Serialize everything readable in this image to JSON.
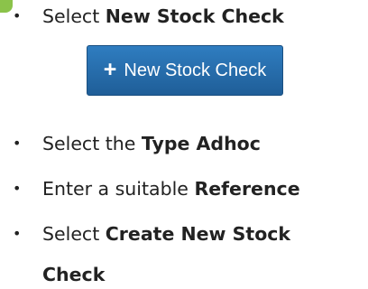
{
  "badge": {
    "color": "#8bc34a"
  },
  "bullets": {
    "marker": "•"
  },
  "steps": [
    {
      "prefix": "Select ",
      "bold": "New Stock Check"
    },
    {
      "prefix": "Select the ",
      "bold": "Type Adhoc"
    },
    {
      "prefix": "Enter a suitable ",
      "bold": "Reference"
    },
    {
      "prefix": "Select ",
      "bold": "Create New Stock",
      "continuation": "Check"
    }
  ],
  "button": {
    "icon": "plus-icon",
    "icon_glyph": "+",
    "label": "New Stock Check"
  }
}
